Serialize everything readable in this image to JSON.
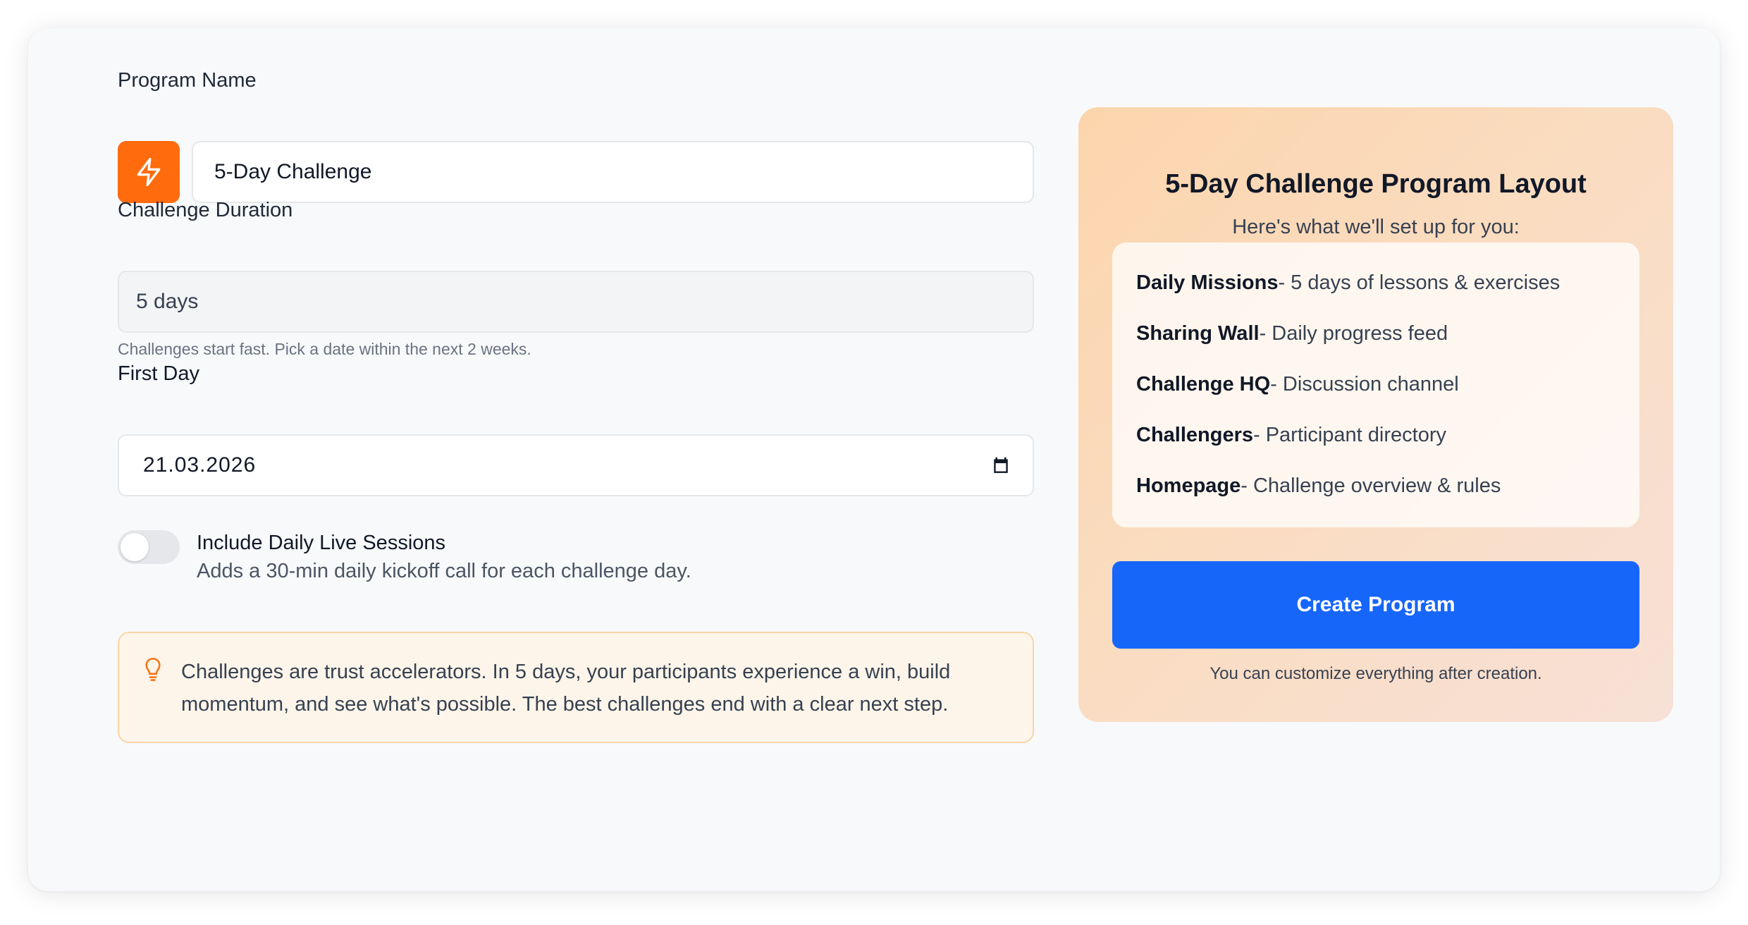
{
  "form": {
    "program_name_label": "Program Name",
    "program_icon": "lightning-bolt-icon",
    "program_name_value": "5-Day Challenge",
    "duration_label": "Challenge Duration",
    "duration_value": "5 days",
    "duration_helper": "Challenges start fast. Pick a date within the next 2 weeks.",
    "first_day_label": "First Day",
    "first_day_value": "21.03.2026",
    "calendar_icon": "calendar-icon",
    "live_sessions_toggle": {
      "on": false,
      "title": "Include Daily Live Sessions",
      "description": "Adds a 30-min daily kickoff call for each challenge day."
    },
    "tip": {
      "icon": "lightbulb-icon",
      "text": "Challenges are trust accelerators. In 5 days, your participants experience a win, build momentum, and see what's possible. The best challenges end with a clear next step."
    }
  },
  "summary": {
    "title": "5-Day Challenge Program Layout",
    "subtitle": "Here's what we'll set up for you:",
    "items": [
      {
        "title": "Daily Missions",
        "description": "- 5 days of lessons & exercises"
      },
      {
        "title": "Sharing Wall",
        "description": "- Daily progress feed"
      },
      {
        "title": "Challenge HQ",
        "description": "- Discussion channel"
      },
      {
        "title": "Challengers",
        "description": "- Participant directory"
      },
      {
        "title": "Homepage",
        "description": "- Challenge overview & rules"
      }
    ],
    "create_button_label": "Create Program",
    "note": "You can customize everything after creation."
  },
  "colors": {
    "accent_orange": "#ff6b0d",
    "primary_blue": "#1766fa",
    "panel_gradient_start": "#fcd5ac",
    "panel_gradient_end": "#f7e0d6",
    "tip_background": "#fdf5ea",
    "tip_border": "#fbd5a8"
  }
}
